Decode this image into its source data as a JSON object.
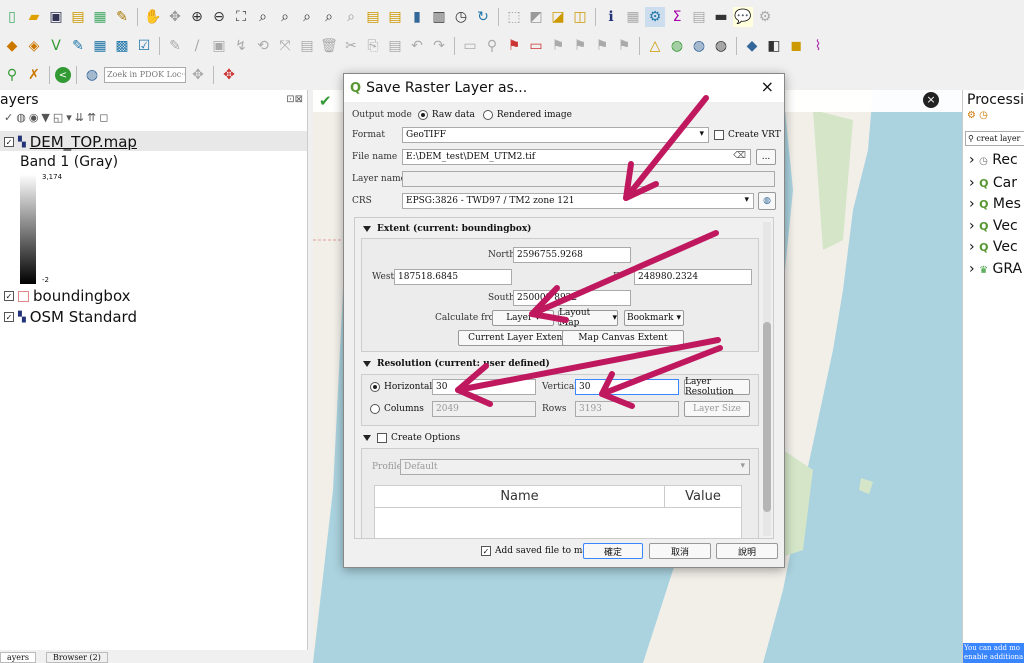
{
  "toolbar3": {
    "search_placeholder": "Zoek in PDOK Loc···"
  },
  "layers_panel": {
    "title": "ayers",
    "items": [
      {
        "name": "DEM_TOP.map",
        "checked": true
      },
      {
        "name": "boundingbox",
        "checked": true
      },
      {
        "name": "OSM Standard",
        "checked": true
      }
    ],
    "band_label": "Band 1 (Gray)",
    "legend_max": "3,174",
    "legend_min": "-2",
    "tabs": [
      "ayers",
      "Browser (2)"
    ]
  },
  "processing_panel": {
    "title": "Processi",
    "search_placeholder": "creat layer",
    "items": [
      "Rec",
      "Car",
      "Mes",
      "Vec",
      "Vec",
      "GRA"
    ],
    "footer": "You can add mo enable additiona"
  },
  "dialog": {
    "title": "Save Raster Layer as...",
    "close": "×",
    "output_mode_label": "Output mode",
    "raw_data": "Raw data",
    "rendered_image": "Rendered image",
    "format_label": "Format",
    "format_value": "GeoTIFF",
    "create_vrt": "Create VRT",
    "file_name_label": "File name",
    "file_name_value": "E:\\DEM_test\\DEM_UTM2.tif",
    "browse": "...",
    "layer_name_label": "Layer name",
    "layer_name_value": "",
    "crs_label": "CRS",
    "crs_value": "EPSG:3826 - TWD97 / TM2 zone 121",
    "extent_title": "Extent (current: boundingbox)",
    "north_label": "North",
    "north_value": "2596755.9268",
    "west_label": "West",
    "west_value": "187518.6845",
    "east_label": "E",
    "east_value": "248980.2324",
    "south_label": "South",
    "south_value": "250009  8922",
    "calc_from": "Calculate from",
    "layer_btn": "Layer",
    "layout_map_btn": "Layout Map",
    "bookmark_btn": "Bookmark",
    "current_layer_extent": "Current Layer Extent",
    "map_canvas_extent": "Map Canvas Extent",
    "resolution_title": "Resolution (current: user defined)",
    "horizontal_label": "Horizontal",
    "horizontal_value": "30",
    "vertical_label": "Vertical",
    "vertical_value": "30",
    "layer_resolution": "Layer Resolution",
    "columns_label": "Columns",
    "columns_value": "2049",
    "rows_label": "Rows",
    "rows_value": "3193",
    "layer_size": "Layer Size",
    "create_options": "Create Options",
    "profile_label": "Profile",
    "profile_value": "Default",
    "col_name": "Name",
    "col_value": "Value",
    "add_saved": "Add saved file to map",
    "ok": "確定",
    "cancel": "取消",
    "help": "說明"
  },
  "colors": {
    "arrow": "#c0185f",
    "qgis_green": "#589632",
    "map_water": "#aad3df",
    "map_land": "#f2efe9"
  }
}
